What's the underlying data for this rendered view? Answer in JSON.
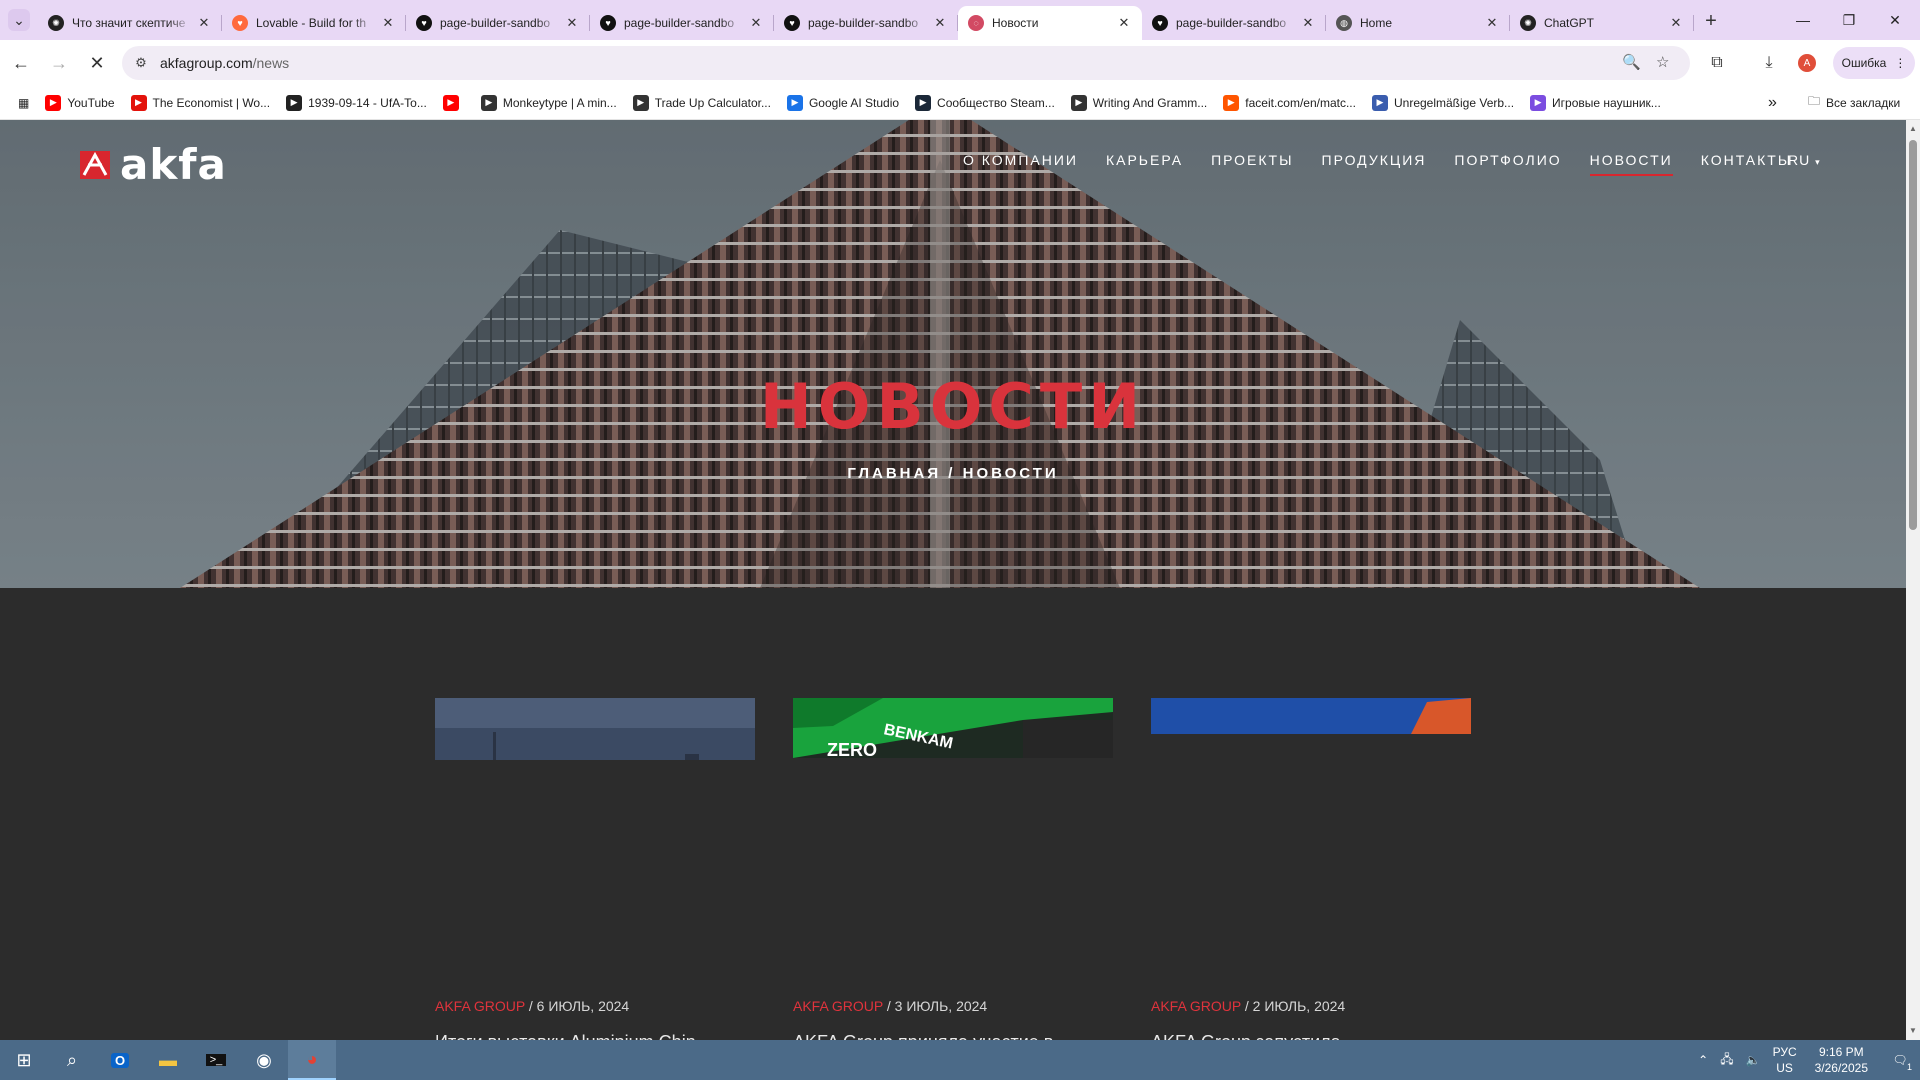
{
  "browser": {
    "tabs": [
      {
        "title": "Что значит скептиче",
        "favicon": "chatgpt-icon",
        "active": false
      },
      {
        "title": "Lovable - Build for th",
        "favicon": "lovable-heart-icon",
        "active": false
      },
      {
        "title": "page-builder-sandbo",
        "favicon": "heart-icon",
        "active": false
      },
      {
        "title": "page-builder-sandbo",
        "favicon": "heart-icon",
        "active": false
      },
      {
        "title": "page-builder-sandbo",
        "favicon": "heart-icon",
        "active": false
      },
      {
        "title": "Новости",
        "favicon": "loading-spinner-icon",
        "active": true
      },
      {
        "title": "page-builder-sandbo",
        "favicon": "heart-icon",
        "active": false
      },
      {
        "title": "Home",
        "favicon": "globe-icon",
        "active": false
      },
      {
        "title": "ChatGPT",
        "favicon": "chatgpt-icon",
        "active": false
      }
    ],
    "new_tab": "+",
    "url_host": "akfagroup.com",
    "url_path": "/news",
    "error_button": "Ошибка",
    "profile_initial": "A",
    "bookmarks": [
      {
        "label": "YouTube",
        "icon": "youtube-icon",
        "color": "#ff0000"
      },
      {
        "label": "The Economist | Wo...",
        "icon": "economist-icon",
        "color": "#e3120b"
      },
      {
        "label": "1939-09-14 - UfA-To...",
        "icon": "film-icon",
        "color": "#222222"
      },
      {
        "label": "",
        "icon": "youtube-icon",
        "color": "#ff0000"
      },
      {
        "label": "Monkeytype | A min...",
        "icon": "globe-icon",
        "color": "#333333"
      },
      {
        "label": "Trade Up Calculator...",
        "icon": "globe-icon",
        "color": "#333333"
      },
      {
        "label": "Google AI Studio",
        "icon": "ai-studio-icon",
        "color": "#1a73e8"
      },
      {
        "label": "Сообщество Steam...",
        "icon": "steam-icon",
        "color": "#1b2838"
      },
      {
        "label": "Writing And Gramm...",
        "icon": "globe-icon",
        "color": "#333333"
      },
      {
        "label": "faceit.com/en/matc...",
        "icon": "faceit-icon",
        "color": "#ff5500"
      },
      {
        "label": "Unregelmäßige Verb...",
        "icon": "shield-icon",
        "color": "#3a5dae"
      },
      {
        "label": "Игровые наушник...",
        "icon": "headset-icon",
        "color": "#7b4de0"
      }
    ],
    "bookmarks_overflow": "»",
    "all_bookmarks": "Все закладки"
  },
  "site": {
    "logo_text": "akfa",
    "nav": [
      {
        "label": "О КОМПАНИИ",
        "active": false
      },
      {
        "label": "КАРЬЕРА",
        "active": false
      },
      {
        "label": "ПРОЕКТЫ",
        "active": false
      },
      {
        "label": "ПРОДУКЦИЯ",
        "active": false
      },
      {
        "label": "ПОРТФОЛИО",
        "active": false
      },
      {
        "label": "НОВОСТИ",
        "active": true
      },
      {
        "label": "КОНТАКТЫ",
        "active": false
      }
    ],
    "language": "RU",
    "hero_title": "НОВОСТИ",
    "breadcrumb": "ГЛАВНАЯ / НОВОСТИ",
    "accent_color": "#d9333c",
    "cards": [
      {
        "category": "AKFA GROUP",
        "date": " / 6 ИЮЛЬ, 2024",
        "headline": "Итоги выставки Aluminium Chin"
      },
      {
        "category": "AKFA GROUP",
        "date": " / 3 ИЮЛЬ, 2024",
        "headline": "AKFA Group приняла участие в"
      },
      {
        "category": "AKFA GROUP",
        "date": " / 2 ИЮЛЬ, 2024",
        "headline": "AKFA Group запустила"
      }
    ],
    "card2_sign": "BENKAM"
  },
  "taskbar": {
    "language_top": "РУС",
    "language_bottom": "US",
    "time": "9:16 PM",
    "date": "3/26/2025",
    "notifications": "1"
  }
}
